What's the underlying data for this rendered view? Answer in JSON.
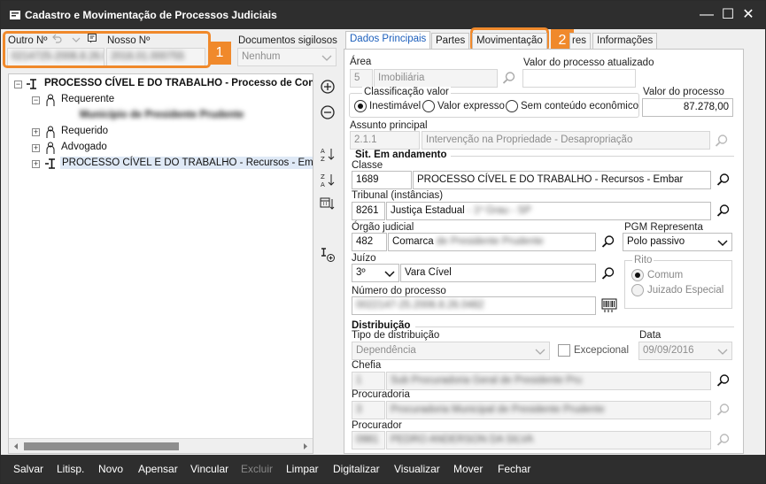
{
  "window": {
    "title": "Cadastro e Movimentação de Processos Judiciais",
    "minimize_glyph": "—",
    "maximize_glyph": "☐",
    "close_glyph": "✕"
  },
  "header": {
    "outro_label": "Outro Nº",
    "outro_value": "0214725-2006.8.26.0482",
    "nosso_label": "Nosso Nº",
    "nosso_value": "2016.01.000755",
    "docs_label": "Documentos sigilosos",
    "docs_value": "Nenhum"
  },
  "callouts": {
    "one": "1",
    "two": "2"
  },
  "tree": {
    "root": "PROCESSO CÍVEL E DO TRABALHO - Processo de Conhecim",
    "requerente": "Requerente",
    "requerente_child": "Município de Presidente Prudente",
    "requerido": "Requerido",
    "advogado": "Advogado",
    "recursos": "PROCESSO CÍVEL E DO TRABALHO - Recursos - Embargo"
  },
  "tabs": [
    "Dados Principais",
    "Partes",
    "Movimentação",
    "res",
    "Informações"
  ],
  "main": {
    "area_label": "Área",
    "area_code": "5",
    "area_name": "Imobiliária",
    "valor_atual_label": "Valor do processo atualizado",
    "valor_atual_value": "",
    "classificacao_label": "Classificação valor",
    "radio_inestimavel": "Inestimável",
    "radio_expresso": "Valor expresso",
    "radio_sem": "Sem conteúdo econômico",
    "valor_label": "Valor do processo",
    "valor_value": "87.278,00",
    "assunto_label": "Assunto principal",
    "assunto_code": "2.1.1",
    "assunto_name": "Intervenção na Propriedade - Desapropriação",
    "sit_title": "Sit. Em andamento",
    "classe_label": "Classe",
    "classe_code": "1689",
    "classe_name": "PROCESSO CÍVEL E DO TRABALHO - Recursos - Embar",
    "tribunal_label": "Tribunal (instâncias)",
    "tribunal_code": "8261",
    "tribunal_name": "Justiça Estadual",
    "tribunal_suffix": " - 1º Grau - SP",
    "orgao_label": "Órgão judicial",
    "orgao_code": "482",
    "orgao_name": "Comarca",
    "orgao_suffix": " de Presidente Prudente",
    "pgm_label": "PGM Representa",
    "pgm_value": "Polo passivo",
    "juizo_label": "Juízo",
    "juizo_num": "3º",
    "juizo_name": "Vara Cível",
    "rito_label": "Rito",
    "rito_comum": "Comum",
    "rito_juizado": "Juizado Especial",
    "numero_label": "Número do processo",
    "numero_value": "0022147-25.2006.8.26.0482",
    "dist_title": "Distribuição",
    "tipo_label": "Tipo de distribuição",
    "tipo_value": "Dependência",
    "excepcional_label": "Excepcional",
    "data_label": "Data",
    "data_value": "09/09/2016",
    "chefia_label": "Chefia",
    "chefia_code": "1",
    "chefia_name": "Sub Procuradoria Geral de Presidente Pru",
    "procuradoria_label": "Procuradoria",
    "procuradoria_code": "3",
    "procuradoria_name": "Procuradoria Municipal de Presidente Prudente",
    "procurador_label": "Procurador",
    "procurador_code": "0981",
    "procurador_name": "PEDRO ANDERSON DA SILVA"
  },
  "bottom": [
    "Salvar",
    "Litisp.",
    "Novo",
    "Apensar",
    "Vincular",
    "Excluir",
    "Limpar",
    "Digitalizar",
    "Visualizar",
    "Mover",
    "Fechar"
  ],
  "colors": {
    "accent": "#f0892b",
    "link": "#1c5fbc",
    "bar": "#2e2e2e"
  }
}
